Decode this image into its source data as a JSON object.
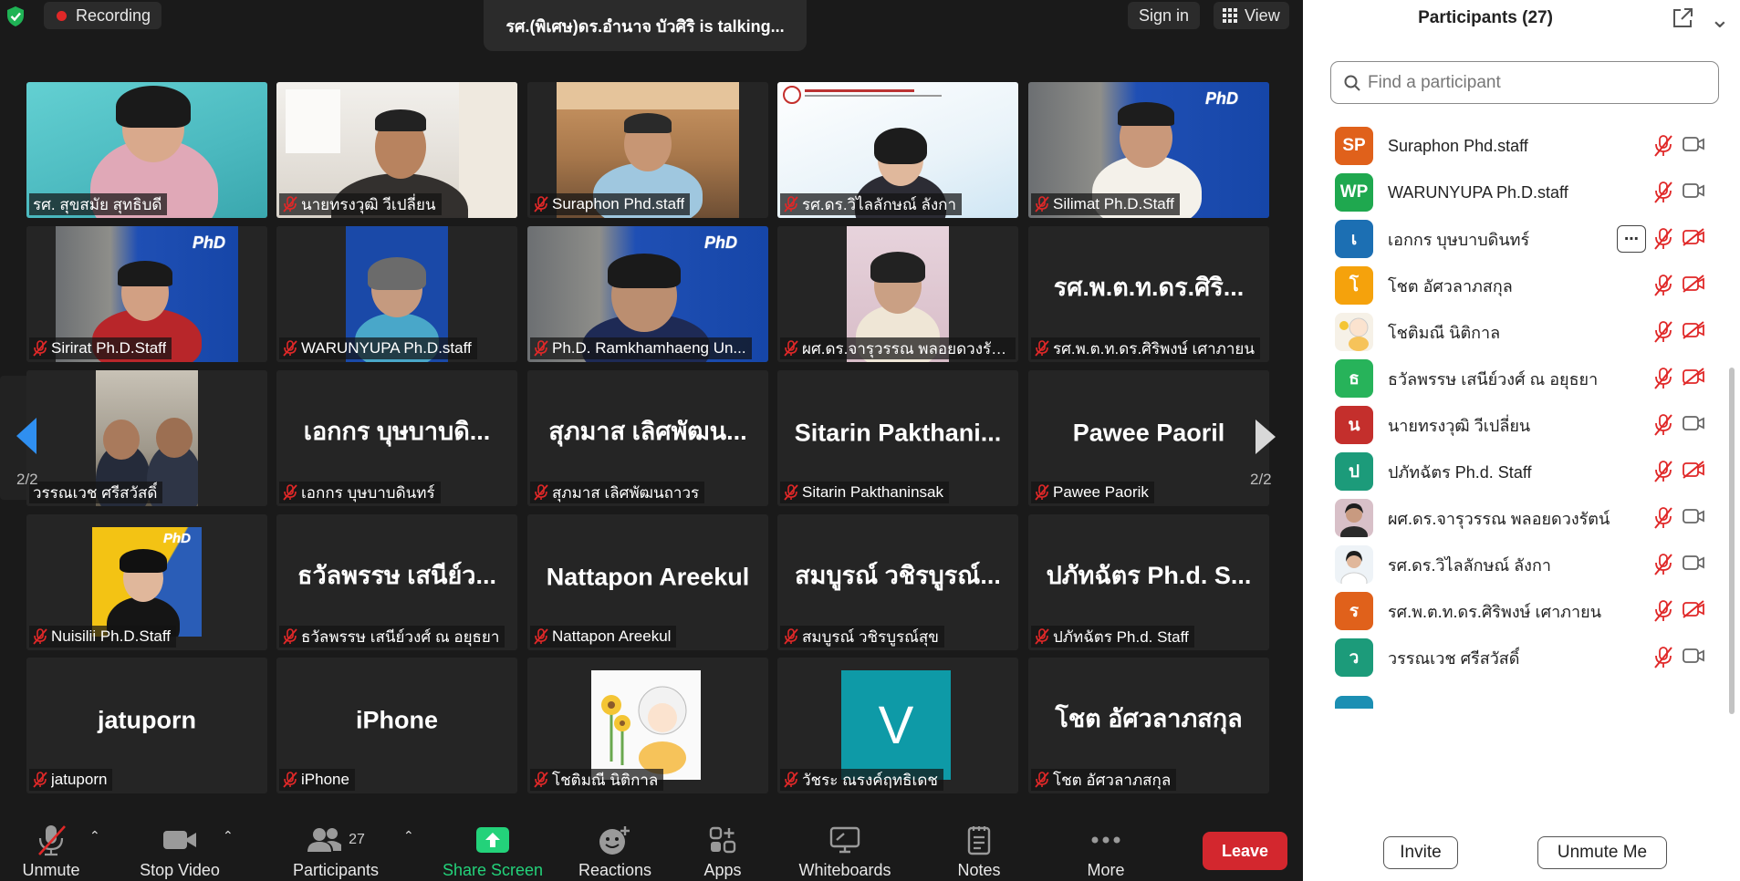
{
  "recording": {
    "label": "Recording"
  },
  "talking": "รศ.(พิเศษ)ดร.อำนาจ บัวศิริ is  talking...",
  "top_right": {
    "signin": "Sign in",
    "view": "View"
  },
  "pager": {
    "left": "2/2",
    "right": "2/2"
  },
  "tiles": [
    {
      "label": "รศ. สุขสมัย สุทธิบดี",
      "muted": false
    },
    {
      "label": "นายทรงวุฒิ วีเปลี่ยน",
      "muted": true
    },
    {
      "label": "Suraphon Phd.staff",
      "muted": true
    },
    {
      "label": "รศ.ดร.วิไลลักษณ์ ลังกา",
      "muted": true
    },
    {
      "label": "Silimat Ph.D.Staff",
      "muted": true
    },
    {
      "label": "Sirirat Ph.D.Staff",
      "muted": true
    },
    {
      "label": "WARUNYUPA Ph.D.staff",
      "muted": true
    },
    {
      "label": "Ph.D. Ramkhamhaeng Un...",
      "muted": true
    },
    {
      "label": "ผศ.ดร.จารุวรรณ พลอยดวงรัตน์",
      "muted": true
    },
    {
      "label": "รศ.พ.ต.ท.ดร.ศิริพงษ์ เศาภายน",
      "big": "รศ.พ.ต.ท.ดร.ศิริ...",
      "muted": true
    },
    {
      "label": "วรรณเวช ศรีสวัสดิ์",
      "muted": true
    },
    {
      "label": "เอกกร บุษบาบดินทร์",
      "big": "เอกกร บุษบาบดิ...",
      "muted": true
    },
    {
      "label": "สุภมาส เลิศพัฒนถาวร",
      "big": "สุภมาส เลิศพัฒน...",
      "muted": true
    },
    {
      "label": "Sitarin Pakthaninsak",
      "big": "Sitarin  Pakthani...",
      "muted": true
    },
    {
      "label": "Pawee  Paorik",
      "big": "Pawee  Paoril",
      "muted": true
    },
    {
      "label": "Nuisilii Ph.D.Staff",
      "muted": true
    },
    {
      "label": "ธวัลพรรษ เสนีย์วงศ์ ณ อยุธยา",
      "big": "ธวัลพรรษ เสนีย์ว...",
      "muted": true
    },
    {
      "label": "Nattapon Areekul",
      "big": "Nattapon Areekul",
      "muted": true
    },
    {
      "label": "สมบูรณ์ วชิรบูรณ์สุข",
      "big": "สมบูรณ์ วชิรบูรณ์...",
      "muted": true
    },
    {
      "label": "ปภัทฉัตร Ph.d. Staff",
      "big": "ปภัทฉัตร Ph.d. S...",
      "muted": true
    },
    {
      "label": "jatuporn",
      "big": "jatuporn",
      "muted": true
    },
    {
      "label": "iPhone",
      "big": "iPhone",
      "muted": true
    },
    {
      "label": "โชติมณี นิติกาล",
      "muted": true
    },
    {
      "label": "วัชระ ณรงค์ฤทธิเดช",
      "avatar_letter": "V",
      "muted": true
    },
    {
      "label": "โชต อัศวลาภสกุล",
      "big": "โชต อัศวลาภสกุล",
      "muted": true
    }
  ],
  "toolbar": {
    "unmute": "Unmute",
    "stop_video": "Stop Video",
    "participants": "Participants",
    "participants_count": "27",
    "share_screen": "Share Screen",
    "reactions": "Reactions",
    "apps": "Apps",
    "whiteboards": "Whiteboards",
    "notes": "Notes",
    "more": "More",
    "leave": "Leave"
  },
  "panel": {
    "title": "Participants (27)",
    "search_placeholder": "Find a participant",
    "invite": "Invite",
    "unmute_me": "Unmute Me",
    "participants": [
      {
        "initials": "SP",
        "name": "Suraphon Phd.staff",
        "color": "#e0611b",
        "video": true
      },
      {
        "initials": "WP",
        "name": "WARUNYUPA Ph.D.staff",
        "color": "#1fa84f",
        "video": true
      },
      {
        "initials": "เ",
        "name": "เอกกร บุษบาบดินทร์",
        "color": "#1c6fb3",
        "video": false,
        "more": "⋯"
      },
      {
        "initials": "โ",
        "name": "โชต อัศวลาภสกุล",
        "color": "#f5a20c",
        "video": false
      },
      {
        "initials": "",
        "name": "โชติมณี นิติกาล",
        "color": "#f6f1e7",
        "video": false,
        "photo": "cartoon"
      },
      {
        "initials": "ธ",
        "name": "ธวัลพรรษ เสนีย์วงศ์ ณ อยุธยา",
        "color": "#27b35a",
        "video": false
      },
      {
        "initials": "น",
        "name": "นายทรงวุฒิ วีเปลี่ยน",
        "color": "#c42f2c",
        "video": true
      },
      {
        "initials": "ป",
        "name": "ปภัทฉัตร Ph.d. Staff",
        "color": "#1c9b7a",
        "video": false
      },
      {
        "initials": "",
        "name": "ผศ.ดร.จารุวรรณ พลอยดวงรัตน์",
        "color": "#d8c0c8",
        "video": true,
        "photo": "woman"
      },
      {
        "initials": "",
        "name": "รศ.ดร.วิไลลักษณ์ ลังกา",
        "color": "#eef3f7",
        "video": true,
        "photo": "woman-white"
      },
      {
        "initials": "ร",
        "name": "รศ.พ.ต.ท.ดร.ศิริพงษ์ เศาภายน",
        "color": "#e0611b",
        "video": false
      },
      {
        "initials": "ว",
        "name": "วรรณเวช ศรีสวัสดิ์",
        "color": "#1c9b7a",
        "video": true
      }
    ]
  },
  "colors": {
    "accent_green": "#23d27a",
    "leave_red": "#d3272e",
    "muted_red": "#e02828"
  }
}
